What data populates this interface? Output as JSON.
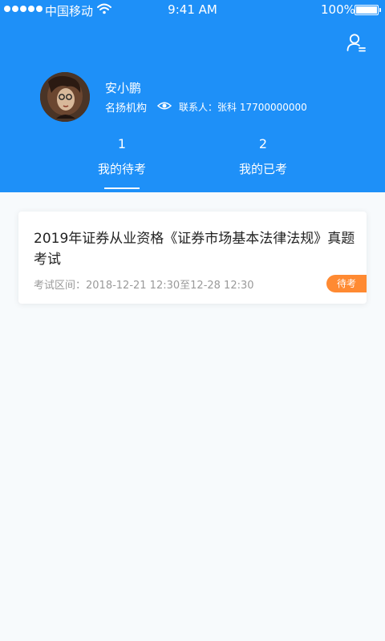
{
  "status_bar": {
    "carrier": "中国移动",
    "time": "9:41 AM",
    "battery": "100%"
  },
  "user": {
    "name": "安小鹏",
    "organization": "名扬机构",
    "contact": "联系人：张科 17700000000"
  },
  "tabs": [
    {
      "count": "1",
      "label": "我的待考",
      "active": true
    },
    {
      "count": "2",
      "label": "我的已考",
      "active": false
    }
  ],
  "exam_card": {
    "title": "2019年证券从业资格《证券市场基本法律法规》真题考试",
    "time_range": "考试区间：2018-12-21 12:30至12-28 12:30",
    "status": "待考"
  },
  "colors": {
    "brand_blue": "#1e90f8",
    "badge_orange": "#ff8a32",
    "page_bg": "#f7fafc"
  },
  "icons": {
    "profile": "user-profile-icon",
    "eye": "eye-icon",
    "wifi": "wifi-icon",
    "battery": "battery-icon"
  }
}
